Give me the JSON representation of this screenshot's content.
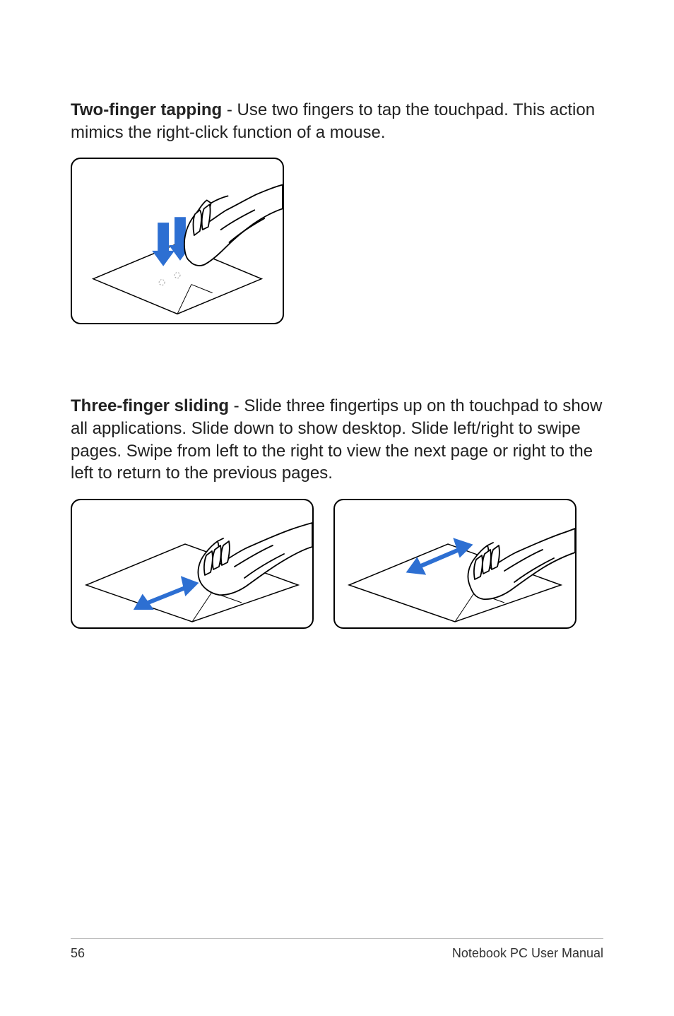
{
  "section1": {
    "title": "Two-finger tapping",
    "body": " - Use two fingers to tap the touchpad. This action mimics the right-click function of a mouse."
  },
  "section2": {
    "title": "Three-finger sliding",
    "body": " - Slide three fingertips up on th touchpad to show all applications. Slide down to show desktop. Slide left/right to swipe pages. Swipe from left to the right to view the next page or right to the left to return to the previous pages."
  },
  "footer": {
    "page": "56",
    "doc": "Notebook PC User Manual"
  },
  "colors": {
    "arrow": "#2d6fd2",
    "arrowLight": "#5a9ae8",
    "stroke": "#000000"
  }
}
